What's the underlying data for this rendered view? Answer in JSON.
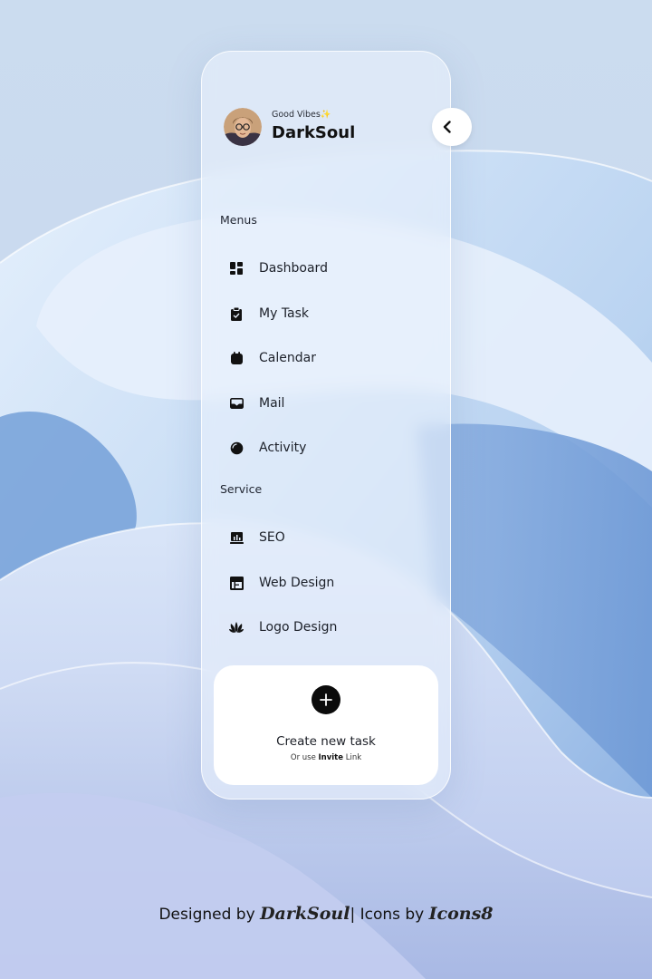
{
  "profile": {
    "greeting": "Good Vibes",
    "greeting_emoji": "✨",
    "name": "DarkSoul"
  },
  "sidebar": {
    "collapse_icon": "chevron-left-icon",
    "menus_label": "Menus",
    "menu_items": [
      {
        "label": "Dashboard",
        "icon": "dashboard-icon"
      },
      {
        "label": "My Task",
        "icon": "clipboard-icon"
      },
      {
        "label": "Calendar",
        "icon": "calendar-icon"
      },
      {
        "label": "Mail",
        "icon": "mail-icon"
      },
      {
        "label": "Activity",
        "icon": "activity-icon"
      }
    ],
    "service_label": "Service",
    "service_items": [
      {
        "label": "SEO",
        "icon": "seo-chart-icon"
      },
      {
        "label": "Web Design",
        "icon": "web-design-icon"
      },
      {
        "label": "Logo Design",
        "icon": "logo-design-icon"
      }
    ]
  },
  "create_task": {
    "icon": "plus-icon",
    "title": "Create new task",
    "sub_prefix": "Or use ",
    "sub_bold": "Invite",
    "sub_suffix": " Link"
  },
  "footer": {
    "designed_by": "Designed by",
    "designer": "DarkSoul",
    "separator": "|",
    "icons_by": "Icons by",
    "icon_source": "Icons8"
  },
  "colors": {
    "background": "#c9d9ee",
    "panel": "#e8f0fb",
    "accent": "#0b0b0b",
    "card": "#ffffff"
  }
}
